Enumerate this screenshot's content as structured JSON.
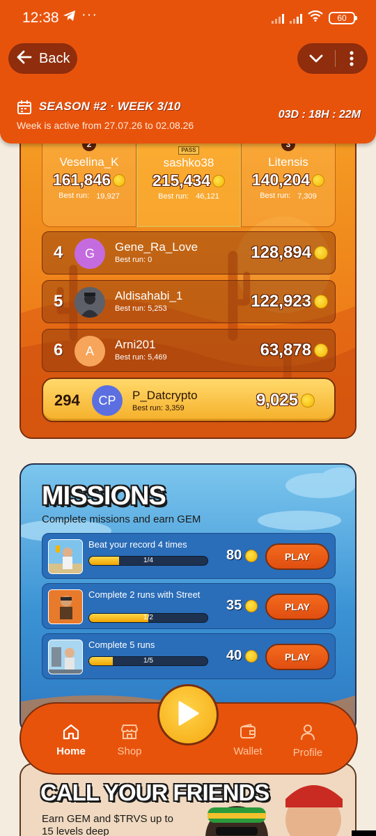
{
  "status_bar": {
    "time": "12:38",
    "dots": "···",
    "battery": "60"
  },
  "header": {
    "back_label": "Back",
    "season_title": "SEASON #2 · WEEK 3/10",
    "season_subtitle": "Week is active from 27.07.26 to 02.08.26",
    "countdown": "03D : 18H : 22M"
  },
  "leaderboard": {
    "podium": [
      {
        "rank": "2",
        "name": "Veselina_K",
        "score": "161,846",
        "best_label": "Best run:",
        "best_value": "19,927"
      },
      {
        "rank": "1",
        "name": "sashko38",
        "score": "215,434",
        "best_label": "Best run:",
        "best_value": "46,121",
        "tag": "PASS"
      },
      {
        "rank": "3",
        "name": "Litensis",
        "score": "140,204",
        "best_label": "Best run:",
        "best_value": "7,309"
      }
    ],
    "rows": [
      {
        "rank": "4",
        "avatar_letter": "G",
        "avatar_color": "#c56be0",
        "name": "Gene_Ra_Love",
        "best": "Best run:  0",
        "score": "128,894"
      },
      {
        "rank": "5",
        "avatar_letter": "",
        "avatar_color": "#6b6f78",
        "name": "Aldisahabi_1",
        "best": "Best run:  5,253",
        "score": "122,923"
      },
      {
        "rank": "6",
        "avatar_letter": "A",
        "avatar_color": "#f7a55a",
        "name": "Arni201",
        "best": "Best run:  5,469",
        "score": "63,878"
      }
    ],
    "me": {
      "rank": "294",
      "avatar_letter": "CP",
      "name": "P_Datcrypto",
      "best": "Best run:  3,359",
      "score": "9,025"
    }
  },
  "missions": {
    "title": "MISSIONS",
    "subtitle": "Complete missions and earn GEM",
    "items": [
      {
        "title": "Beat your record 4 times",
        "progress_text": "1/4",
        "progress": 0.25,
        "reward": "80",
        "play_label": "PLAY"
      },
      {
        "title": "Complete 2 runs with Street",
        "progress_text": "1/2",
        "progress": 0.5,
        "reward": "35",
        "play_label": "PLAY"
      },
      {
        "title": "Complete 5 runs",
        "progress_text": "1/5",
        "progress": 0.2,
        "reward": "40",
        "play_label": "PLAY"
      }
    ]
  },
  "friends": {
    "title": "CALL YOUR FRIENDS",
    "subtitle": "Earn GEM and $TRVS up to 15 levels deep"
  },
  "nav": {
    "items": [
      {
        "label": "Home",
        "active": true
      },
      {
        "label": "Shop",
        "active": false
      },
      {
        "label": "Wallet",
        "active": false
      },
      {
        "label": "Profile",
        "active": false
      }
    ]
  },
  "colors": {
    "brand_orange": "#e8530c",
    "dark_brown": "#8f2d0c",
    "gold": "#f5b02a",
    "mission_blue": "#2a6db8"
  }
}
